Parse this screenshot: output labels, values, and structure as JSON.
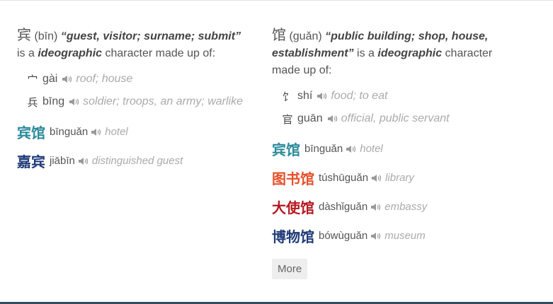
{
  "colors": {
    "teal": "#2a8a9a",
    "orange": "#e6502a",
    "red": "#b5181f",
    "navy": "#1f3a78"
  },
  "left": {
    "char": "宾",
    "pinyin": "(bīn)",
    "definition": "“guest, visitor; surname; submit”",
    "is_a": "is a",
    "kind": "ideographic",
    "made_of": "character made up of:",
    "components": [
      {
        "hz": "宀",
        "py": "gài",
        "def": "roof; house"
      },
      {
        "hz": "兵",
        "py": "bīng",
        "def": "soldier; troops, an army; warlike"
      }
    ],
    "words": [
      {
        "hz": "宾馆",
        "py": "bīnguǎn",
        "def": "hotel",
        "color": "#2a8a9a"
      },
      {
        "hz": "嘉宾",
        "py": "jiābīn",
        "def": "distinguished guest",
        "color": "#1f3a78"
      }
    ]
  },
  "right": {
    "char": "馆",
    "pinyin": "(guǎn)",
    "definition": "“public building; shop, house, establishment”",
    "is_a": "is a",
    "kind": "ideographic",
    "made_of": "character made up of:",
    "components": [
      {
        "hz": "饣",
        "py": "shí",
        "def": "food; to eat"
      },
      {
        "hz": "官",
        "py": "guān",
        "def": "official, public servant"
      }
    ],
    "words": [
      {
        "hz": "宾馆",
        "py": "bīnguǎn",
        "def": "hotel",
        "color": "#2a8a9a"
      },
      {
        "hz": "图书馆",
        "py": "túshūguǎn",
        "def": "library",
        "color": "#e6502a"
      },
      {
        "hz": "大使馆",
        "py": "dàshǐguǎn",
        "def": "embassy",
        "color": "#b5181f"
      },
      {
        "hz": "博物馆",
        "py": "bówùguǎn",
        "def": "museum",
        "color": "#1f3a78"
      }
    ],
    "more_label": "More"
  }
}
